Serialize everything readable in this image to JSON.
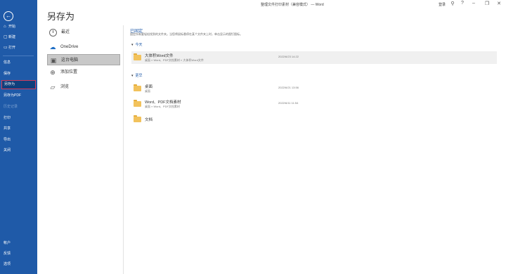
{
  "titlebar": {
    "doc_title": "整理文件打印素材（兼容模式） — Word",
    "user": "登录",
    "icons": [
      "pen-icon",
      "help-icon",
      "minimize-icon",
      "restore-icon",
      "close-icon"
    ],
    "icon_glyphs": [
      "⚲",
      "?",
      "–",
      "❐",
      "✕"
    ]
  },
  "sidebar": {
    "back_glyph": "←",
    "items": [
      {
        "label": "开始",
        "glyph": "⌂"
      },
      {
        "label": "新建",
        "glyph": "▢"
      },
      {
        "label": "打开",
        "glyph": "▭"
      },
      {
        "label": "信息",
        "glyph": ""
      },
      {
        "label": "保存",
        "glyph": ""
      },
      {
        "label": "另存为",
        "glyph": ""
      },
      {
        "label": "另存为PDF",
        "glyph": ""
      },
      {
        "label": "历史记录",
        "glyph": ""
      },
      {
        "label": "打印",
        "glyph": ""
      },
      {
        "label": "共享",
        "glyph": ""
      },
      {
        "label": "导出",
        "glyph": ""
      },
      {
        "label": "关闭",
        "glyph": ""
      }
    ],
    "bottom": [
      {
        "label": "帐户"
      },
      {
        "label": "反馈"
      },
      {
        "label": "选项"
      }
    ],
    "active_color": "#d23b5a",
    "bg_color": "#1f5aa8"
  },
  "page_title": "另存为",
  "locations": [
    {
      "label": "最近",
      "icon": "clock-icon"
    },
    {
      "label": "OneDrive",
      "icon": "cloud-icon",
      "glyph": "☁"
    },
    {
      "label": "这台电脑",
      "icon": "computer-icon",
      "glyph": "▣"
    },
    {
      "label": "添加位置",
      "icon": "globe-icon",
      "glyph": "⊕"
    },
    {
      "label": "浏览",
      "icon": "folder-open-icon",
      "glyph": "▱"
    }
  ],
  "pinned": {
    "title": "已固定",
    "desc": "固定所有要轻松找到的文件夹。当您将鼠标悬停在某个文件夹上时，单击显示的图钉图标。"
  },
  "groups": {
    "today": "今天",
    "earlier": "更早"
  },
  "caret": "▾",
  "folders_today": [
    {
      "name": "大体积Word文件",
      "path": "桌面 » Word、PDF文档素材 » 大体积Word文件",
      "date": "2022/6/23 14:22"
    }
  ],
  "folders_earlier": [
    {
      "name": "桌面",
      "path": "桌面",
      "date": "2022/6/21 13:56"
    },
    {
      "name": "Word、PDF文档素材",
      "path": "桌面 » Word、PDF文档素材",
      "date": "2022/6/11 11:54"
    },
    {
      "name": "文档",
      "path": "",
      "date": ""
    }
  ]
}
